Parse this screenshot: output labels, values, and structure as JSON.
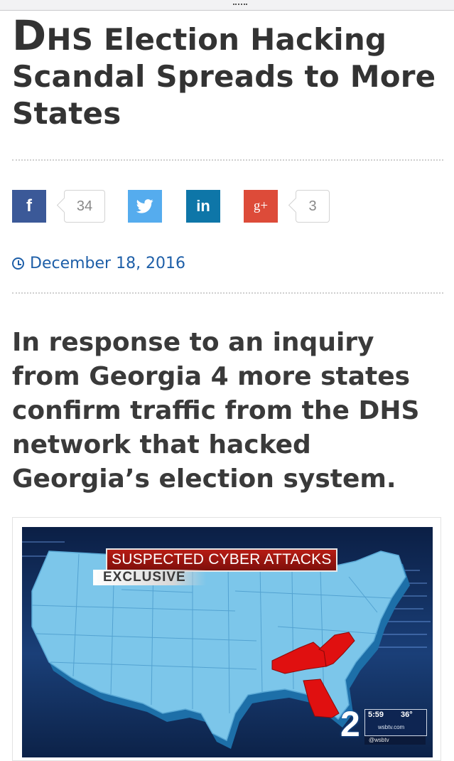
{
  "article": {
    "title_cap": "D",
    "title_rest": "HS Election Hacking Scandal Spreads to More States",
    "date": "December 18, 2016",
    "lede": "In response to an inquiry from Georgia 4 more states confirm traffic from the DHS network that hacked Georgia’s election system."
  },
  "share": {
    "facebook": {
      "icon": "f",
      "count": "34"
    },
    "twitter": {
      "icon": "twitter-bird-icon"
    },
    "linkedin": {
      "icon": "in"
    },
    "google_plus": {
      "icon": "g+",
      "count": "3"
    }
  },
  "image": {
    "banner_title": "SUSPECTED CYBER ATTACKS",
    "banner_tag": "EXCLUSIVE",
    "channel_number": "2",
    "time": "5:59",
    "temperature": "36°",
    "site": "wsbtv.com",
    "handle": "@wsbtv"
  },
  "colors": {
    "facebook": "#3b5998",
    "twitter": "#55acee",
    "linkedin": "#0e76a8",
    "google_plus": "#dd4b39",
    "date_link": "#1e5fa8",
    "highlighted_states": "#e01010",
    "map_fill": "#7cc6ea"
  }
}
